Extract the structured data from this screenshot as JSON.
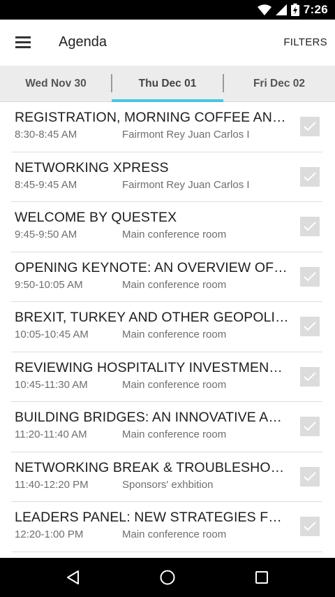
{
  "status_bar": {
    "time": "7:26",
    "icons": [
      "wifi-icon",
      "cell-signal-icon",
      "battery-icon"
    ]
  },
  "app_bar": {
    "title": "Agenda",
    "filters_label": "FILTERS",
    "menu_icon": "hamburger-menu-icon"
  },
  "tabs": [
    {
      "label": "Wed Nov 30",
      "selected": false
    },
    {
      "label": "Thu Dec 01",
      "selected": true
    },
    {
      "label": "Fri Dec 02",
      "selected": false
    }
  ],
  "accent_color": "#43c6e4",
  "agenda_items": [
    {
      "title": "REGISTRATION, MORNING COFFEE AND NETWORKING",
      "time": "8:30-8:45 AM",
      "location": "Fairmont Rey Juan Carlos I"
    },
    {
      "title": "NETWORKING XPRESS",
      "time": "8:45-9:45 AM",
      "location": "Fairmont Rey Juan Carlos I"
    },
    {
      "title": "WELCOME BY QUESTEX",
      "time": "9:45-9:50 AM",
      "location": "Main conference room"
    },
    {
      "title": "OPENING KEYNOTE: AN OVERVIEW OF THE INDUSTRY",
      "time": "9:50-10:05 AM",
      "location": "Main conference room"
    },
    {
      "title": "BREXIT, TURKEY AND OTHER GEOPOLITICAL ISSUES",
      "time": "10:05-10:45 AM",
      "location": "Main conference room"
    },
    {
      "title": "REVIEWING HOSPITALITY INVESTMENT TRENDS",
      "time": "10:45-11:30 AM",
      "location": "Main conference room"
    },
    {
      "title": "BUILDING BRIDGES: AN INNOVATIVE APPROACH",
      "time": "11:20-11:40 AM",
      "location": "Main conference room"
    },
    {
      "title": "NETWORKING BREAK & TROUBLESHOOTING",
      "time": "11:40-12:20 PM",
      "location": "Sponsors' exhbition"
    },
    {
      "title": "LEADERS PANEL: NEW STRATEGIES FOR GROWTH",
      "time": "12:20-1:00 PM",
      "location": "Main conference room"
    }
  ],
  "nav_bar": {
    "buttons": [
      "back-icon",
      "home-icon",
      "recent-apps-icon"
    ]
  }
}
